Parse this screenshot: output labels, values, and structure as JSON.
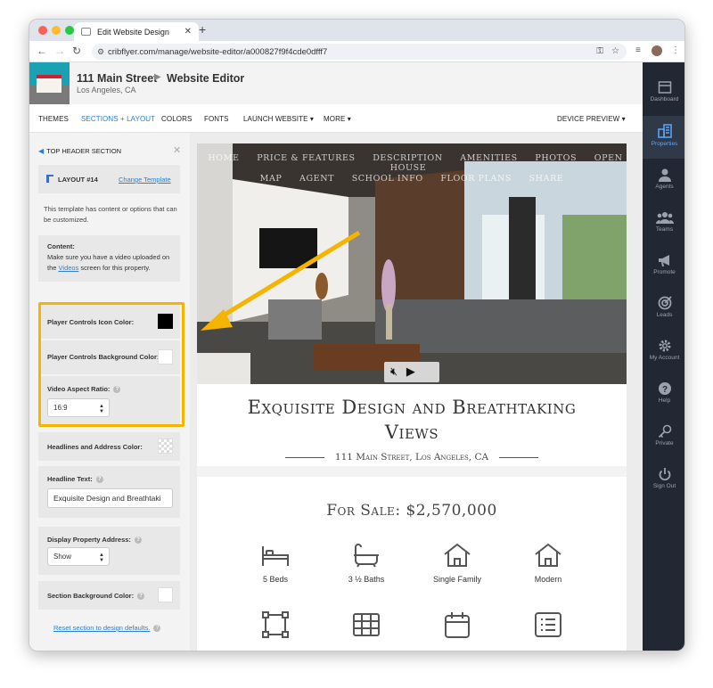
{
  "browser": {
    "tab_title": "Edit Website Design",
    "url": "cribflyer.com/manage/website-editor/a000827f9f4cde0dfff7"
  },
  "header": {
    "address": "111 Main Street",
    "page_title": "Website Editor",
    "city": "Los Angeles, CA"
  },
  "menu": {
    "themes": "THEMES",
    "sections": "SECTIONS + LAYOUT",
    "colors": "COLORS",
    "fonts": "FONTS",
    "launch": "LAUNCH WEBSITE",
    "more": "MORE",
    "device": "DEVICE PREVIEW"
  },
  "panel": {
    "section_title": "TOP HEADER SECTION",
    "layout_label": "LAYOUT #14",
    "change_template": "Change Template",
    "info_text": "This template has content or options that can be customized.",
    "content_title": "Content:",
    "content_text_1": "Make sure you have a video uploaded on the",
    "content_link": "Videos",
    "content_text_2": "screen for this property.",
    "player_icon_color_label": "Player Controls Icon Color:",
    "player_bg_color_label": "Player Controls Background Color:",
    "video_aspect_label": "Video Aspect Ratio:",
    "video_aspect_value": "16:9",
    "headline_color_label": "Headlines and Address Color:",
    "headline_text_label": "Headline Text:",
    "headline_text_value": "Exquisite Design and Breathtaki",
    "display_address_label": "Display Property Address:",
    "display_address_value": "Show",
    "section_bg_label": "Section Background Color:",
    "reset_link": "Reset section to design defaults.",
    "colors": {
      "player_icon": "#000000",
      "player_bg": "#ffffff",
      "highlight": "#f4b400"
    }
  },
  "preview": {
    "nav_row1": [
      "HOME",
      "PRICE & FEATURES",
      "DESCRIPTION",
      "AMENITIES",
      "PHOTOS",
      "OPEN HOUSE"
    ],
    "nav_row2": [
      "MAP",
      "AGENT",
      "SCHOOL INFO",
      "FLOOR PLANS",
      "SHARE"
    ],
    "headline": "Exquisite Design and Breathtaking Views",
    "address_line": "111 Main Street, Los Angeles, CA",
    "sale": "For Sale: $2,570,000",
    "features": [
      "5 Beds",
      "3 ½ Baths",
      "Single Family",
      "Modern"
    ]
  },
  "sidebar": {
    "items": [
      "Dashboard",
      "Properties",
      "Agents",
      "Teams",
      "Promote",
      "Leads",
      "My Account",
      "Help",
      "Private",
      "Sign Out"
    ]
  }
}
